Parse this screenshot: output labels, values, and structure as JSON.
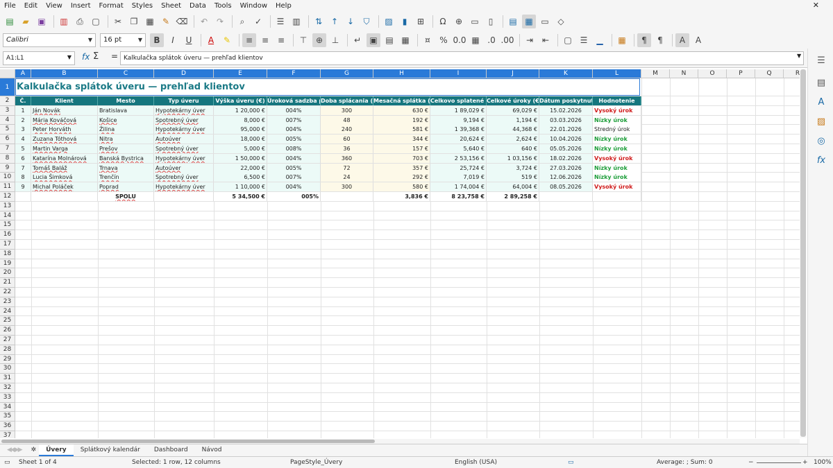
{
  "menu": [
    "File",
    "Edit",
    "View",
    "Insert",
    "Format",
    "Styles",
    "Sheet",
    "Data",
    "Tools",
    "Window",
    "Help"
  ],
  "font": {
    "name": "Calibri",
    "size": "16 pt"
  },
  "formula": {
    "cell_ref": "A1:L1",
    "content": "Kalkulačka splátok úveru — prehľad klientov"
  },
  "columns": [
    "A",
    "B",
    "C",
    "D",
    "E",
    "F",
    "G",
    "H",
    "I",
    "J",
    "K",
    "L",
    "M",
    "N",
    "O",
    "P",
    "Q",
    "R"
  ],
  "rows": [
    "1",
    "2",
    "3",
    "4",
    "5",
    "6",
    "7",
    "8",
    "9",
    "10",
    "11",
    "12",
    "13",
    "14",
    "15",
    "16",
    "17",
    "18",
    "19",
    "20",
    "21",
    "22",
    "23",
    "24",
    "25",
    "26",
    "27",
    "28",
    "29",
    "30",
    "31",
    "32",
    "33",
    "34",
    "35",
    "36",
    "37"
  ],
  "sheet_title": "Kalkulačka splátok úveru — prehľad klientov",
  "headers": [
    "Č.",
    "Klient",
    "Mesto",
    "Typ úveru",
    "Výška úveru (€)",
    "Úroková sadzba p.a.",
    "Doba splácania (mes.)",
    "Mesačná splátka (€)",
    "Celkovo splatené (€)",
    "Celkové úroky (€)",
    "Dátum poskytnutia",
    "Hodnotenie"
  ],
  "data_rows": [
    [
      "1",
      "Ján Novák",
      "Bratislava",
      "Hypotekárny úver",
      "1 20,000 €",
      "004%",
      "300",
      "630 €",
      "1 89,029 €",
      "69,029 €",
      "15.02.2026",
      "Vysoký úrok"
    ],
    [
      "2",
      "Mária Kováčová",
      "Košice",
      "Spotrebný úver",
      "8,000 €",
      "007%",
      "48",
      "192 €",
      "9,194 €",
      "1,194 €",
      "03.03.2026",
      "Nízky úrok"
    ],
    [
      "3",
      "Peter Horváth",
      "Žilina",
      "Hypotekárny úver",
      "95,000 €",
      "004%",
      "240",
      "581 €",
      "1 39,368 €",
      "44,368 €",
      "22.01.2026",
      "Stredný úrok"
    ],
    [
      "4",
      "Zuzana Tóthová",
      "Nitra",
      "Autoúver",
      "18,000 €",
      "005%",
      "60",
      "344 €",
      "20,624 €",
      "2,624 €",
      "10.04.2026",
      "Nízky úrok"
    ],
    [
      "5",
      "Martin Varga",
      "Prešov",
      "Spotrebný úver",
      "5,000 €",
      "008%",
      "36",
      "157 €",
      "5,640 €",
      "640 €",
      "05.05.2026",
      "Nízky úrok"
    ],
    [
      "6",
      "Katarína Molnárová",
      "Banská Bystrica",
      "Hypotekárny úver",
      "1 50,000 €",
      "004%",
      "360",
      "703 €",
      "2 53,156 €",
      "1 03,156 €",
      "18.02.2026",
      "Vysoký úrok"
    ],
    [
      "7",
      "Tomáš Baláž",
      "Trnava",
      "Autoúver",
      "22,000 €",
      "005%",
      "72",
      "357 €",
      "25,724 €",
      "3,724 €",
      "27.03.2026",
      "Nízky úrok"
    ],
    [
      "8",
      "Lucia Šimková",
      "Trenčín",
      "Spotrebný úver",
      "6,500 €",
      "007%",
      "24",
      "292 €",
      "7,019 €",
      "519 €",
      "12.06.2026",
      "Nízky úrok"
    ],
    [
      "9",
      "Michal Poláček",
      "Poprad",
      "Hypotekárny úver",
      "1 10,000 €",
      "004%",
      "300",
      "580 €",
      "1 74,004 €",
      "64,004 €",
      "08.05.2026",
      "Vysoký úrok"
    ]
  ],
  "totals": {
    "label": "SPOLU",
    "amount": "5 34,500 €",
    "rate": "005%",
    "monthly": "3,836 €",
    "total_paid": "8 23,758 €",
    "interest": "2 89,258 €"
  },
  "rating_colors": {
    "Vysoký úrok": "#d01c1c",
    "Nízky úrok": "#1e9e3a",
    "Stredný úrok": "#222222"
  },
  "tabs": [
    "Úvery",
    "Splátkový kalendár",
    "Dashboard",
    "Návod"
  ],
  "status": {
    "sheet": "Sheet 1 of 4",
    "selection": "Selected: 1 row, 12 columns",
    "page_style": "PageStyle_Úvery",
    "language": "English (USA)",
    "summary": "Average: ; Sum: 0",
    "zoom": "100%"
  }
}
